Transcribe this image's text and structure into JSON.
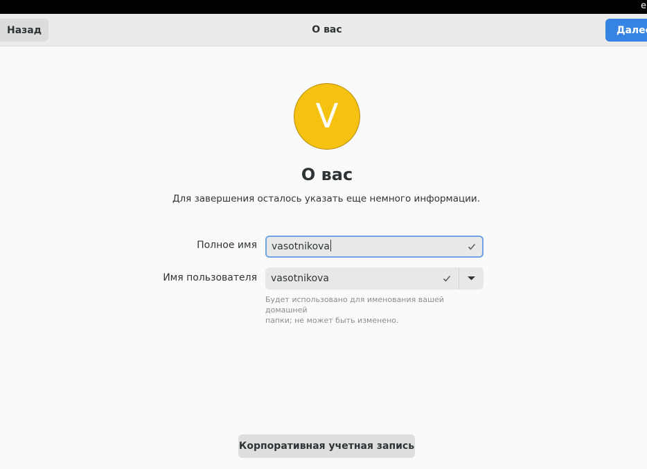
{
  "topbar": {
    "right_text": "e"
  },
  "header": {
    "back_label": "Назад",
    "title": "О вас",
    "next_label": "Далее"
  },
  "avatar": {
    "initial": "V",
    "color": "#f5c211"
  },
  "main": {
    "title": "О вас",
    "subtitle": "Для завершения осталось указать еще немного информации."
  },
  "form": {
    "fullname": {
      "label": "Полное имя",
      "value": "vasotnikova",
      "valid_icon": "check-icon"
    },
    "username": {
      "label": "Имя пользователя",
      "value": "vasotnikova",
      "valid_icon": "check-icon",
      "dropdown_icon": "chevron-down-icon",
      "hint_line1": "Будет использовано для именования вашей домашней",
      "hint_line2": "папки; не может быть изменено."
    }
  },
  "footer": {
    "enterprise_label": "Корпоративная учетная запись"
  },
  "colors": {
    "accent": "#3584e4",
    "focus_ring": "#6fa3e6"
  }
}
